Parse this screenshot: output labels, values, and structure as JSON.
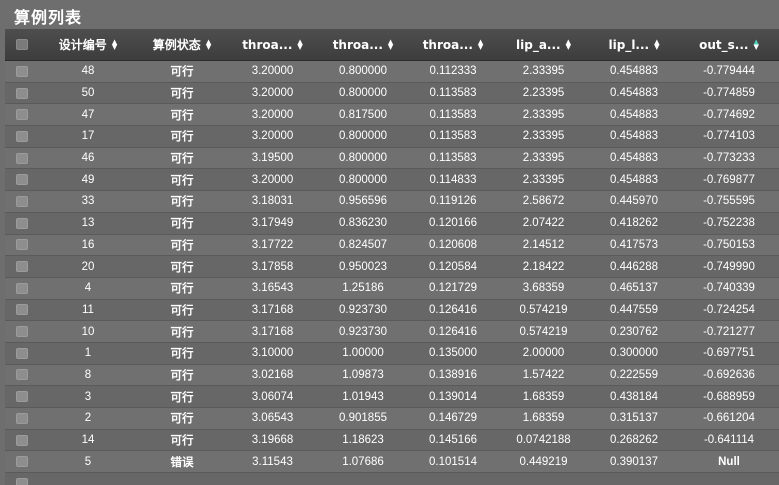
{
  "title": "算例列表",
  "columns": [
    {
      "label": "设计编号",
      "sort": "none"
    },
    {
      "label": "算例状态",
      "sort": "none"
    },
    {
      "label": "throa...",
      "sort": "none"
    },
    {
      "label": "throa...",
      "sort": "none"
    },
    {
      "label": "throa...",
      "sort": "none"
    },
    {
      "label": "lip_a...",
      "sort": "none"
    },
    {
      "label": "lip_l...",
      "sort": "none"
    },
    {
      "label": "out_s...",
      "sort": "desc"
    }
  ],
  "rows": [
    [
      "48",
      "可行",
      "3.20000",
      "0.800000",
      "0.112333",
      "2.33395",
      "0.454883",
      "-0.779444"
    ],
    [
      "50",
      "可行",
      "3.20000",
      "0.800000",
      "0.113583",
      "2.23395",
      "0.454883",
      "-0.774859"
    ],
    [
      "47",
      "可行",
      "3.20000",
      "0.817500",
      "0.113583",
      "2.33395",
      "0.454883",
      "-0.774692"
    ],
    [
      "17",
      "可行",
      "3.20000",
      "0.800000",
      "0.113583",
      "2.33395",
      "0.454883",
      "-0.774103"
    ],
    [
      "46",
      "可行",
      "3.19500",
      "0.800000",
      "0.113583",
      "2.33395",
      "0.454883",
      "-0.773233"
    ],
    [
      "49",
      "可行",
      "3.20000",
      "0.800000",
      "0.114833",
      "2.33395",
      "0.454883",
      "-0.769877"
    ],
    [
      "33",
      "可行",
      "3.18031",
      "0.956596",
      "0.119126",
      "2.58672",
      "0.445970",
      "-0.755595"
    ],
    [
      "13",
      "可行",
      "3.17949",
      "0.836230",
      "0.120166",
      "2.07422",
      "0.418262",
      "-0.752238"
    ],
    [
      "16",
      "可行",
      "3.17722",
      "0.824507",
      "0.120608",
      "2.14512",
      "0.417573",
      "-0.750153"
    ],
    [
      "20",
      "可行",
      "3.17858",
      "0.950023",
      "0.120584",
      "2.18422",
      "0.446288",
      "-0.749990"
    ],
    [
      "4",
      "可行",
      "3.16543",
      "1.25186",
      "0.121729",
      "3.68359",
      "0.465137",
      "-0.740339"
    ],
    [
      "11",
      "可行",
      "3.17168",
      "0.923730",
      "0.126416",
      "0.574219",
      "0.447559",
      "-0.724254"
    ],
    [
      "10",
      "可行",
      "3.17168",
      "0.923730",
      "0.126416",
      "0.574219",
      "0.230762",
      "-0.721277"
    ],
    [
      "1",
      "可行",
      "3.10000",
      "1.00000",
      "0.135000",
      "2.00000",
      "0.300000",
      "-0.697751"
    ],
    [
      "8",
      "可行",
      "3.02168",
      "1.09873",
      "0.138916",
      "1.57422",
      "0.222559",
      "-0.692636"
    ],
    [
      "3",
      "可行",
      "3.06074",
      "1.01943",
      "0.139014",
      "1.68359",
      "0.438184",
      "-0.688959"
    ],
    [
      "2",
      "可行",
      "3.06543",
      "0.901855",
      "0.146729",
      "1.68359",
      "0.315137",
      "-0.661204"
    ],
    [
      "14",
      "可行",
      "3.19668",
      "1.18623",
      "0.145166",
      "0.0742188",
      "0.268262",
      "-0.641114"
    ],
    [
      "5",
      "错误",
      "3.11543",
      "1.07686",
      "0.101514",
      "0.449219",
      "0.390137",
      "Null"
    ],
    [
      "",
      "",
      "",
      "",
      "",
      "",
      "",
      ""
    ]
  ],
  "colors": {
    "panel_bg": "#6e6e6e",
    "header_bg": "#454545",
    "sort_active": "#4fd0b8"
  }
}
